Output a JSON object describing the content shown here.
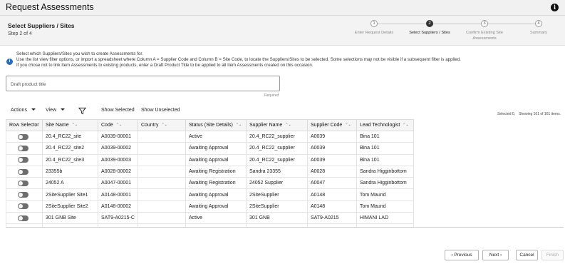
{
  "app": {
    "title": "Request Assessments"
  },
  "page": {
    "title": "Select Suppliers / Sites",
    "step_indicator": "Step 2 of 4"
  },
  "train": {
    "steps": [
      {
        "number": "1",
        "label": "Enter Request Details"
      },
      {
        "number": "2",
        "label": "Select Suppliers / Sites"
      },
      {
        "number": "3",
        "label": "Confirm Existing Site Assessments"
      },
      {
        "number": "4",
        "label": "Summary"
      }
    ]
  },
  "instructions": {
    "line1": "Select which Suppliers/Sites you wish to create Assessments for.",
    "line2": "Use the list view filter options, or import a spreadsheet where Column A = Supplier Code and Column B = Site Code, to locate the Suppliers/Sites to be selected. Some selections may not be visible if a subsequent filter is applied.",
    "line3": "If you chose not to link Item Assessments to existing products, enter a Draft Product Title to be applied to all Item Assessments created on this occasion."
  },
  "draft_title": {
    "placeholder": "Draft product title",
    "value": "",
    "required_label": "Required"
  },
  "toolbar": {
    "actions_label": "Actions",
    "view_label": "View",
    "show_selected_label": "Show Selected",
    "show_unselected_label": "Show Unselected",
    "selected_text": "Selected 0,",
    "showing_text": "Showing 161 of 161 items."
  },
  "table": {
    "columns": [
      "Row Selector",
      "Site Name",
      "Code",
      "Country",
      "Status (Site Details)",
      "Supplier Name",
      "Supplier Code",
      "Lead Technologist"
    ],
    "rows": [
      [
        "20.4_RC22_site",
        "A0039-00001",
        "",
        "Active",
        "20.4_RC22_supplier",
        "A0039",
        "Bina 101"
      ],
      [
        "20.4_RC22_site2",
        "A0039-00002",
        "",
        "Awaiting Approval",
        "20.4_RC22_supplier",
        "A0039",
        "Bina 101"
      ],
      [
        "20.4_RC22_site3",
        "A0039-00003",
        "",
        "Awaiting Approval",
        "20.4_RC22_supplier",
        "A0039",
        "Bina 101"
      ],
      [
        "23355b",
        "A0028-00002",
        "",
        "Awaiting Registration",
        "Sandra 23355",
        "A0028",
        "Sandra Higginbottom"
      ],
      [
        "24052 A",
        "A0047-00001",
        "",
        "Awaiting Registration",
        "24052 Supplier",
        "A0047",
        "Sandra Higginbottom"
      ],
      [
        "2SiteSupplier Site1",
        "A0148-00001",
        "",
        "Awaiting Approval",
        "2SiteSupplier",
        "A0148",
        "Tom Maund"
      ],
      [
        "2SiteSupplier Site2",
        "A0148-00002",
        "",
        "Awaiting Approval",
        "2SiteSupplier",
        "A0148",
        "Tom Maund"
      ],
      [
        "301 GNB Site",
        "SAT9-A0215-C",
        "",
        "Active",
        "301 GNB",
        "SAT9-A0215",
        "HIMANI LAD"
      ]
    ]
  },
  "footer": {
    "previous_label": "Previous",
    "next_label": "Next",
    "cancel_label": "Cancel",
    "finish_label": "Finish"
  },
  "colors": {
    "active_step": "#333333",
    "info_icon": "#2a6ebb",
    "toggle_off": "#6f6f6f"
  }
}
